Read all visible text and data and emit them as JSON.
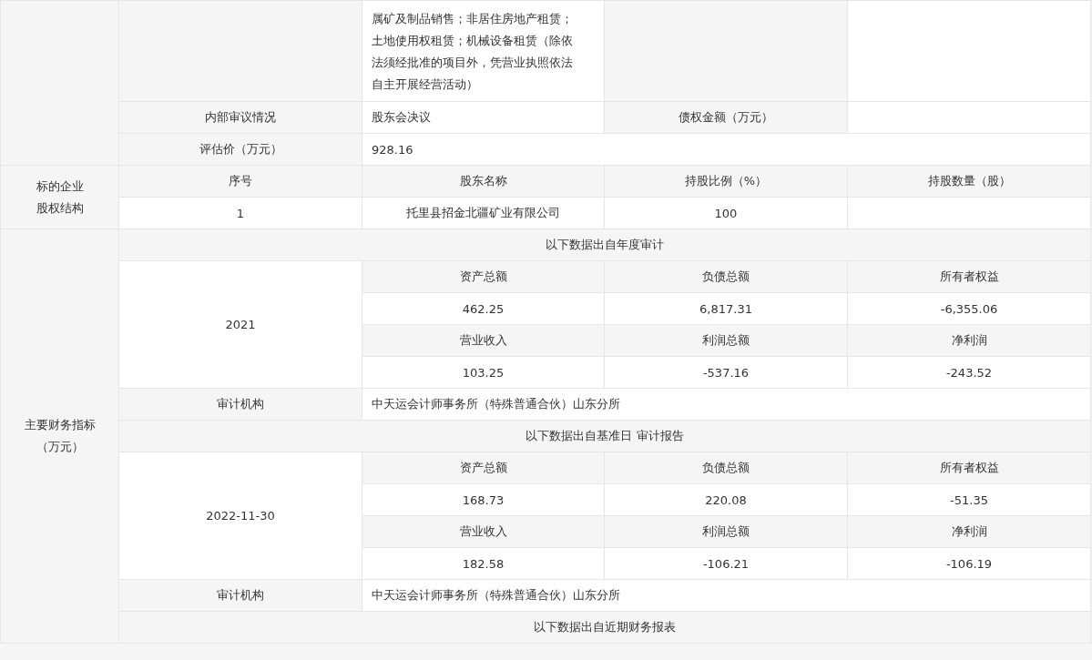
{
  "business_scope": {
    "lines": [
      "属矿及制品销售；非居住房地产租赁；",
      "土地使用权租赁；机械设备租赁（除依",
      "法须经批准的项目外，凭营业执照依法",
      "自主开展经营活动）"
    ]
  },
  "review": {
    "label": "内部审议情况",
    "value": "股东会决议",
    "debt_label": "债权金额（万元）"
  },
  "valuation": {
    "label": "评估价（万元）",
    "value": "928.16"
  },
  "equity": {
    "section_lines": [
      "标的企业",
      "股权结构"
    ],
    "columns": [
      "序号",
      "股东名称",
      "持股比例（%）",
      "持股数量（股）"
    ],
    "rows": [
      [
        "1",
        "托里县招金北疆矿业有限公司",
        "100"
      ]
    ]
  },
  "financials": {
    "section_lines": [
      "主要财务指标",
      "（万元）"
    ],
    "periods": [
      {
        "heading": "以下数据出自年度审计",
        "date": "2021",
        "metrics": [
          [
            {
              "label": "资产总额",
              "value": "462.25"
            },
            {
              "label": "负债总额",
              "value": "6,817.31"
            },
            {
              "label": "所有者权益",
              "value": "-6,355.06"
            }
          ],
          [
            {
              "label": "营业收入",
              "value": "103.25"
            },
            {
              "label": "利润总额",
              "value": "-537.16"
            },
            {
              "label": "净利润",
              "value": "-243.52"
            }
          ]
        ],
        "auditor_label": "审计机构",
        "auditor": "中天运会计师事务所（特殊普通合伙）山东分所"
      },
      {
        "heading": "以下数据出自基准日 审计报告",
        "date": "2022-11-30",
        "metrics": [
          [
            {
              "label": "资产总额",
              "value": "168.73"
            },
            {
              "label": "负债总额",
              "value": "220.08"
            },
            {
              "label": "所有者权益",
              "value": "-51.35"
            }
          ],
          [
            {
              "label": "营业收入",
              "value": "182.58"
            },
            {
              "label": "利润总额",
              "value": "-106.21"
            },
            {
              "label": "净利润",
              "value": "-106.19"
            }
          ]
        ],
        "auditor_label": "审计机构",
        "auditor": "中天运会计师事务所（特殊普通合伙）山东分所"
      },
      {
        "heading": "以下数据出自近期财务报表"
      }
    ]
  }
}
